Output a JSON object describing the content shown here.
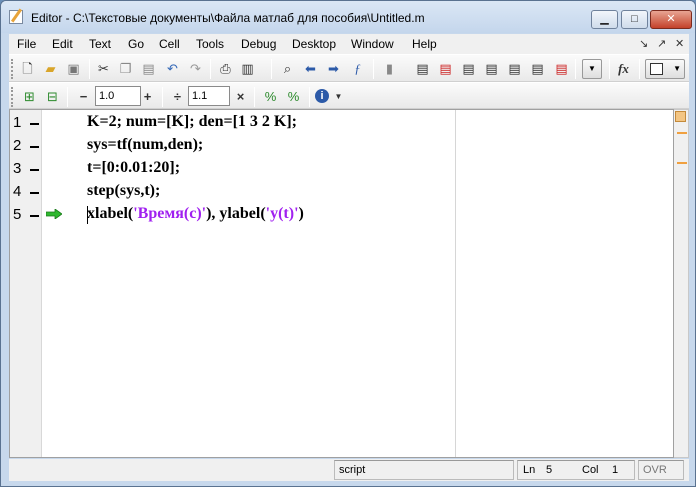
{
  "window": {
    "title": "Editor - C:\\Текстовые документы\\Файла матлаб для пособия\\Untitled.m",
    "controls": {
      "minimize": "▁",
      "maximize": "□",
      "close": "✕"
    }
  },
  "menu": {
    "items": [
      "File",
      "Edit",
      "Text",
      "Go",
      "Cell",
      "Tools",
      "Debug",
      "Desktop",
      "Window",
      "Help"
    ],
    "right_icons": [
      "↘",
      "↗",
      "✕"
    ]
  },
  "toolbar2": {
    "decrement_label": "−",
    "field1_value": "1.0",
    "increment_label": "+",
    "divide_label": "÷",
    "field2_value": "1.1",
    "multiply_label": "×"
  },
  "editor": {
    "lines": [
      {
        "num": "1",
        "code": "K=2; num=[K]; den=[1 3 2 K];"
      },
      {
        "num": "2",
        "code": "sys=tf(num,den);"
      },
      {
        "num": "3",
        "code": "t=[0:0.01:20];"
      },
      {
        "num": "4",
        "code": "step(sys,t);"
      },
      {
        "num": "5",
        "code_parts": [
          "xlabel(",
          "'Время(с)'",
          "), ylabel(",
          "'y(t)'",
          ")"
        ]
      }
    ],
    "current_line": 5
  },
  "status": {
    "mode": "script",
    "ln_label": "Ln",
    "ln_value": "5",
    "col_label": "Col",
    "col_value": "1",
    "ovr": "OVR"
  },
  "colors": {
    "string": "#a020f0",
    "arrow": "#2fb82f"
  }
}
